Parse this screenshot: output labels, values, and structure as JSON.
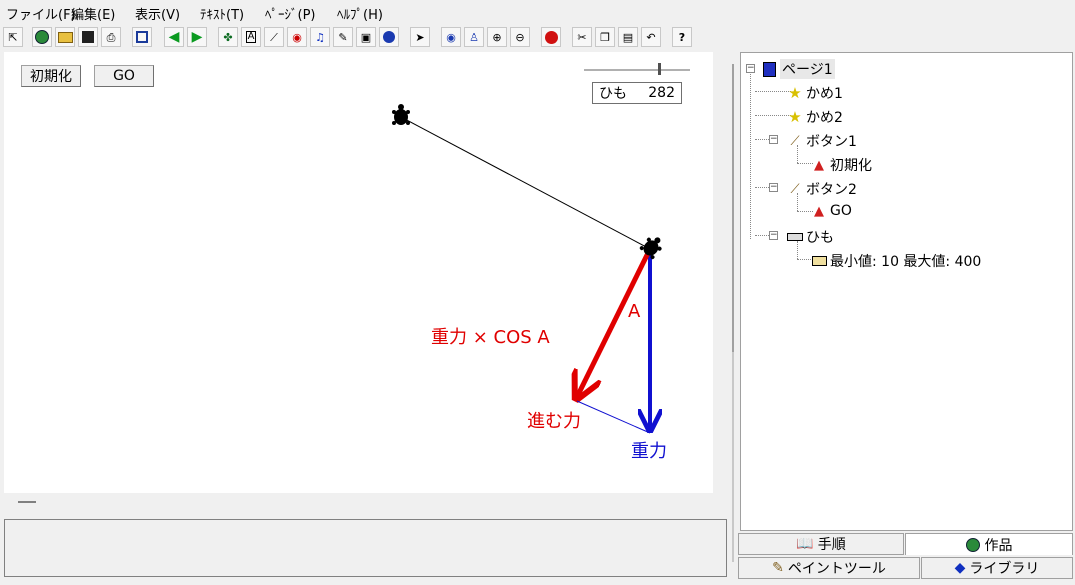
{
  "menu": [
    "ファイル(F)",
    "編集(E)",
    "表示(V)",
    "ﾃｷｽﾄ(T)",
    "ﾍﾟｰｼﾞ(P)",
    "ﾍﾙﾌﾟ(H)"
  ],
  "toolbar_icons": [
    "pointer-icon",
    "globe-icon",
    "open-folder-icon",
    "save-icon",
    "print-icon",
    "panel-icon",
    "back-arrow-icon",
    "forward-arrow-icon",
    "turtle-icon",
    "text-box-icon",
    "antenna-icon",
    "eye-shape-icon",
    "music-icon",
    "pen-icon",
    "movie-icon",
    "ball-icon",
    "select-arrow-icon",
    "view-icon",
    "stamp-icon",
    "zoom-in-icon",
    "zoom-out-icon",
    "stop-hand-icon",
    "cut-icon",
    "copy-icon",
    "paste-icon",
    "undo-icon",
    "help-icon"
  ],
  "canvas": {
    "init_button": "初期化",
    "go_button": "GO",
    "slider": {
      "name": "ひも",
      "value": "282",
      "min": 10,
      "max": 400
    },
    "labels": {
      "gravity_cos": "重力 × COS A",
      "angle": "A",
      "forward_force": "進む力",
      "gravity": "重力"
    },
    "colors": {
      "red": "#e00000",
      "blue": "#1010d0",
      "black": "#000000"
    }
  },
  "tree": {
    "page": "ページ1",
    "items": [
      {
        "label": "かめ1",
        "icon": "star-turtle-icon"
      },
      {
        "label": "かめ2",
        "icon": "star-turtle-icon"
      },
      {
        "label": "ボタン1",
        "icon": "button-object-icon"
      },
      {
        "label": "初期化",
        "icon": "rocket-script-icon"
      },
      {
        "label": "ボタン2",
        "icon": "button-object-icon"
      },
      {
        "label": "GO",
        "icon": "rocket-script-icon"
      },
      {
        "label": "ひも",
        "icon": "slider-object-icon"
      },
      {
        "label": "最小値: 10  最大値: 400",
        "icon": "range-icon"
      }
    ]
  },
  "tabs": {
    "row1": [
      "手順",
      "作品"
    ],
    "row2": [
      "ペイントツール",
      "ライブラリ"
    ]
  }
}
